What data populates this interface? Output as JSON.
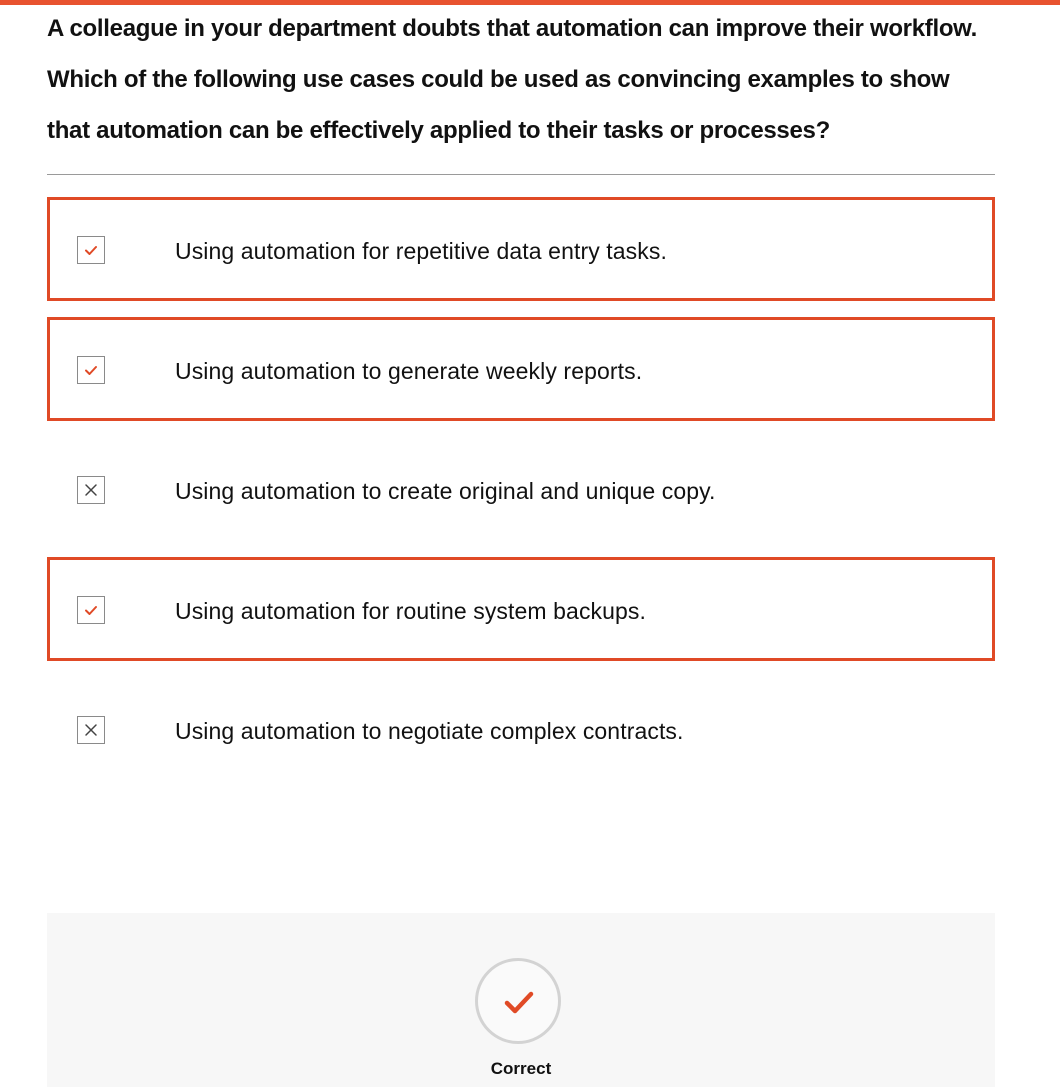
{
  "question": {
    "text": "A colleague in your department doubts that automation can improve their workflow. Which of the following use cases could be used as convincing examples to show that automation can be effectively applied to their tasks or processes?"
  },
  "options": [
    {
      "label": "Using automation for repetitive data entry tasks.",
      "state": "checked",
      "icon": "check-icon"
    },
    {
      "label": "Using automation to generate weekly reports.",
      "state": "checked",
      "icon": "check-icon"
    },
    {
      "label": "Using automation to create original and unique copy.",
      "state": "crossed",
      "icon": "x-icon"
    },
    {
      "label": "Using automation for routine system backups.",
      "state": "checked",
      "icon": "check-icon"
    },
    {
      "label": "Using automation to negotiate complex contracts.",
      "state": "crossed",
      "icon": "x-icon"
    }
  ],
  "feedback": {
    "status": "Correct",
    "icon": "check-icon"
  },
  "colors": {
    "accent": "#e04a26",
    "divider": "#9a9a9a",
    "feedback_bg": "#f7f7f7"
  }
}
